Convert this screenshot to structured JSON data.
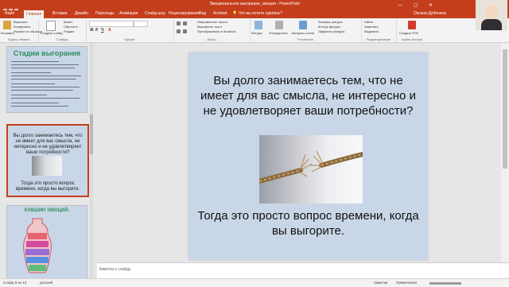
{
  "window": {
    "title": "Эмоциональное выгорание_эмоции - PowerPoint",
    "controls": "— ▢ ✕"
  },
  "menu": {
    "tabs": [
      "Файл",
      "Главная",
      "Вставка",
      "Дизайн",
      "Переходы",
      "Анимация",
      "Слайд-шоу",
      "Рецензирование",
      "Вид",
      "Acrobat"
    ],
    "active_index": 1,
    "tell_me": "Что вы хотите сделать?",
    "user": "Оксана Дубинина"
  },
  "ribbon": {
    "clipboard": {
      "group": "Буфер обмена",
      "paste": "Вставить",
      "cut": "Вырезать",
      "copy": "Копировать",
      "format_painter": "Формат по образцу"
    },
    "slides": {
      "group": "Слайды",
      "new_slide": "Создать слайд",
      "layout": "Макет",
      "reset": "Сбросить",
      "section": "Раздел"
    },
    "font": {
      "group": "Шрифт",
      "name": "",
      "size": ""
    },
    "paragraph": {
      "group": "Абзац"
    },
    "text_dir": {
      "direction": "Направление текста",
      "align": "Выровнять текст",
      "smartart": "Преобразовать в SmartArt"
    },
    "drawing": {
      "group": "Рисование",
      "shapes": "Фигуры",
      "arrange": "Упорядочить",
      "quick_styles": "Экспресс-стили",
      "fill": "Заливка фигуры",
      "outline": "Контур фигуры",
      "effects": "Эффекты фигуры"
    },
    "editing": {
      "group": "Редактирование",
      "find": "Найти",
      "replace": "Заменить",
      "select": "Выделить"
    },
    "acrobat": {
      "group": "Adobe Acrobat",
      "create_pdf": "Создать PDF"
    }
  },
  "thumbnails": [
    {
      "number": "",
      "title": "Стадии выгорания"
    },
    {
      "number": "",
      "top_text": "Вы долго занимаетесь тем, что не имеет для вас смысла, не интересно и не удовлетворяет ваши потребности?",
      "bottom_text": "Тогда это просто вопрос времени, когда вы выгорите."
    },
    {
      "number": "",
      "title": "КУВШИН ЭМОЦИЙ."
    }
  ],
  "slide": {
    "top_text": "Вы долго занимаетесь тем, что не имеет для вас смысла, не интересно и не удовлетворяет ваши потребности?",
    "bottom_text": "Тогда это просто вопрос времени, когда вы выгорите."
  },
  "notes": {
    "placeholder": "Заметки к слайду"
  },
  "status": {
    "slide_counter": "Слайд 9 из 13",
    "language": "русский",
    "notes_btn": "Заметки",
    "comments_btn": "Примечания"
  }
}
